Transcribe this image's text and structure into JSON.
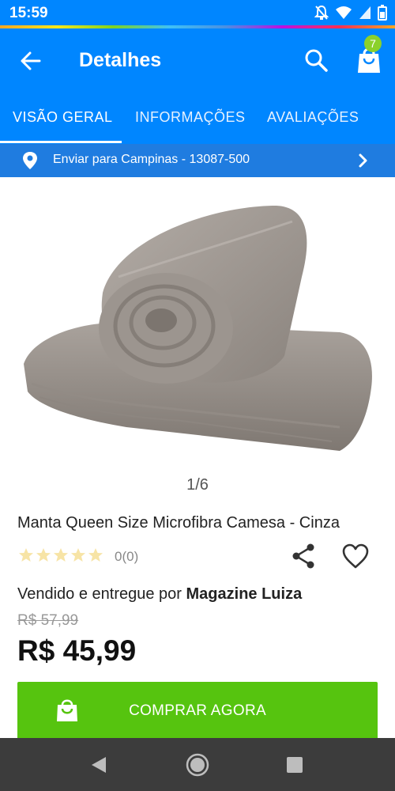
{
  "status_bar": {
    "time": "15:59"
  },
  "app_bar": {
    "title": "Detalhes",
    "cart_count": "7"
  },
  "tabs": [
    {
      "label": "VISÃO GERAL",
      "active": true
    },
    {
      "label": "INFORMAÇÕES",
      "active": false
    },
    {
      "label": "AVALIAÇÕES",
      "active": false
    }
  ],
  "shipping": {
    "text": "Enviar para Campinas - 13087-500"
  },
  "product": {
    "image_pager": "1/6",
    "name": "Manta Queen Size Microfibra Camesa  - Cinza",
    "rating_text": "0(0)",
    "rating_value": 0,
    "rating_max": 5,
    "seller_prefix": "Vendido e entregue por",
    "seller_name": "Magazine Luiza",
    "old_price": "R$ 57,99",
    "price": "R$ 45,99"
  },
  "buy_button": {
    "label": "COMPRAR AGORA"
  },
  "colors": {
    "brand_blue": "#0086ff",
    "buy_green": "#56c40f",
    "badge_green": "#8bd12b"
  },
  "icons": [
    "arrow-back-icon",
    "search-icon",
    "shopping-bag-icon",
    "location-pin-icon",
    "chevron-right-icon",
    "star-icon",
    "share-icon",
    "heart-icon",
    "nav-back-icon",
    "nav-home-icon",
    "nav-recent-icon"
  ]
}
